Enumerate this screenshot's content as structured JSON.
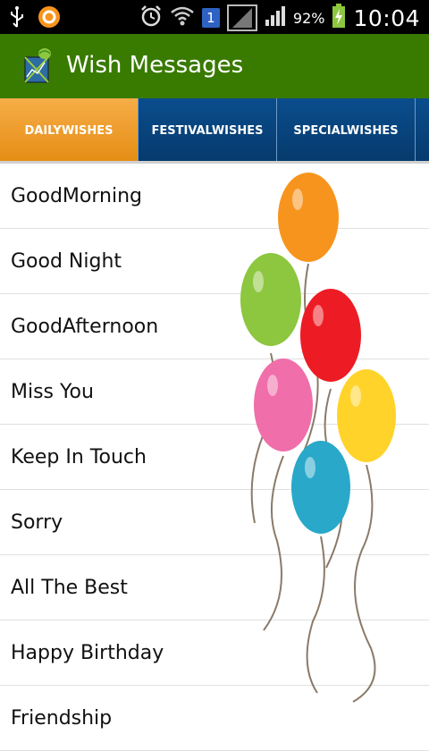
{
  "status_bar": {
    "battery": "92%",
    "time": "10:04",
    "sim_badge": "1",
    "icons": [
      "usb-icon",
      "app-circle-icon",
      "alarm-icon",
      "wifi-icon",
      "sim-badge-icon",
      "signal-box-icon",
      "signal-bars-icon",
      "battery-charging-icon"
    ]
  },
  "action_bar": {
    "title": "Wish Messages",
    "color": "#397a00"
  },
  "tabs": [
    {
      "label": "DAILYWISHES",
      "active": true
    },
    {
      "label": "FESTIVALWISHES",
      "active": false
    },
    {
      "label": "SPECIALWISHES",
      "active": false
    }
  ],
  "list": {
    "items": [
      {
        "label": "GoodMorning"
      },
      {
        "label": "Good Night"
      },
      {
        "label": "GoodAfternoon"
      },
      {
        "label": "Miss You"
      },
      {
        "label": "Keep In Touch"
      },
      {
        "label": "Sorry"
      },
      {
        "label": "All The Best"
      },
      {
        "label": "Happy Birthday"
      },
      {
        "label": "Friendship"
      }
    ]
  },
  "colors": {
    "active_tab": "#f0a030",
    "inactive_tab": "#08457e",
    "balloons": [
      "#f7941d",
      "#8dc63f",
      "#ed1c24",
      "#f06eaa",
      "#ffd32a",
      "#29a8c9"
    ]
  }
}
